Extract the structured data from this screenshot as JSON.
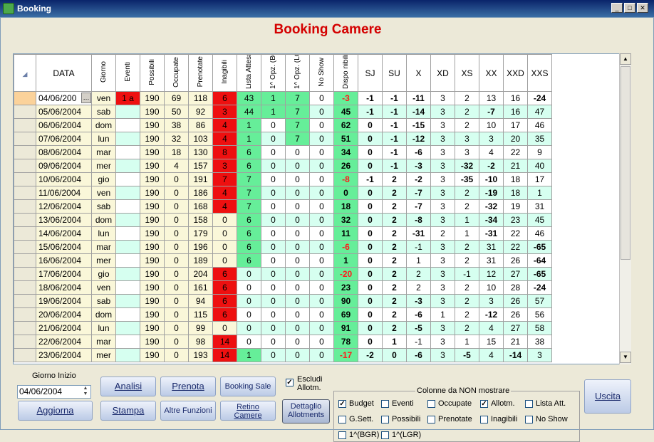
{
  "window": {
    "title": "Booking"
  },
  "heading": "Booking Camere",
  "columns": [
    "Giorno",
    "Eventi",
    "Possibili",
    "Occupate",
    "Prenotate",
    "Inagibili",
    "Lista Attesa",
    "1^ Opz. (BGR)",
    "1^ Opz. (LGR)",
    "No Show",
    "Dispo nibili",
    "SJ",
    "SU",
    "X",
    "XD",
    "XS",
    "XX",
    "XXD",
    "XXS"
  ],
  "data_header": "DATA",
  "colors": {
    "red": "#ee1010",
    "green_light": "#66ee99",
    "cyan_light": "#d6fff0",
    "yellow_light": "#faf7d9",
    "orange": "#fbd29a",
    "dispo_neg": "#ff1a1a",
    "title_red": "#d40000"
  },
  "rows": [
    {
      "date": "04/06/200",
      "day": "ven",
      "eventi": "1 a",
      "poss": "190",
      "occ": "69",
      "pren": "118",
      "inag": "6",
      "lista": "43",
      "bgr": "1",
      "lgr": "7",
      "noshow": "0",
      "dispo": "-3",
      "sj": "-1",
      "su": "-1",
      "x": "-11",
      "xd": "3",
      "xs": "2",
      "xx": "13",
      "xxd": "16",
      "xxs": "-24"
    },
    {
      "date": "05/06/2004",
      "day": "sab",
      "eventi": "",
      "poss": "190",
      "occ": "50",
      "pren": "92",
      "inag": "3",
      "lista": "44",
      "bgr": "1",
      "lgr": "7",
      "noshow": "0",
      "dispo": "45",
      "sj": "-1",
      "su": "-1",
      "x": "-14",
      "xd": "3",
      "xs": "2",
      "xx": "-7",
      "xxd": "16",
      "xxs": "47"
    },
    {
      "date": "06/06/2004",
      "day": "dom",
      "eventi": "",
      "poss": "190",
      "occ": "38",
      "pren": "86",
      "inag": "4",
      "lista": "1",
      "bgr": "0",
      "lgr": "7",
      "noshow": "0",
      "dispo": "62",
      "sj": "0",
      "su": "-1",
      "x": "-15",
      "xd": "3",
      "xs": "2",
      "xx": "10",
      "xxd": "17",
      "xxs": "46"
    },
    {
      "date": "07/06/2004",
      "day": "lun",
      "eventi": "",
      "poss": "190",
      "occ": "32",
      "pren": "103",
      "inag": "4",
      "lista": "1",
      "bgr": "0",
      "lgr": "7",
      "noshow": "0",
      "dispo": "51",
      "sj": "0",
      "su": "-1",
      "x": "-12",
      "xd": "3",
      "xs": "3",
      "xx": "3",
      "xxd": "20",
      "xxs": "35"
    },
    {
      "date": "08/06/2004",
      "day": "mar",
      "eventi": "",
      "poss": "190",
      "occ": "18",
      "pren": "130",
      "inag": "8",
      "lista": "6",
      "bgr": "0",
      "lgr": "0",
      "noshow": "0",
      "dispo": "34",
      "sj": "0",
      "su": "-1",
      "x": "-6",
      "xd": "3",
      "xs": "3",
      "xx": "4",
      "xxd": "22",
      "xxs": "9"
    },
    {
      "date": "09/06/2004",
      "day": "mer",
      "eventi": "",
      "poss": "190",
      "occ": "4",
      "pren": "157",
      "inag": "3",
      "lista": "6",
      "bgr": "0",
      "lgr": "0",
      "noshow": "0",
      "dispo": "26",
      "sj": "0",
      "su": "-1",
      "x": "-3",
      "xd": "3",
      "xs": "-32",
      "xx": "-2",
      "xxd": "21",
      "xxs": "40"
    },
    {
      "date": "10/06/2004",
      "day": "gio",
      "eventi": "",
      "poss": "190",
      "occ": "0",
      "pren": "191",
      "inag": "7",
      "lista": "7",
      "bgr": "0",
      "lgr": "0",
      "noshow": "0",
      "dispo": "-8",
      "sj": "-1",
      "su": "2",
      "x": "-2",
      "xd": "3",
      "xs": "-35",
      "xx": "-10",
      "xxd": "18",
      "xxs": "17"
    },
    {
      "date": "11/06/2004",
      "day": "ven",
      "eventi": "",
      "poss": "190",
      "occ": "0",
      "pren": "186",
      "inag": "4",
      "lista": "7",
      "bgr": "0",
      "lgr": "0",
      "noshow": "0",
      "dispo": "0",
      "sj": "0",
      "su": "2",
      "x": "-7",
      "xd": "3",
      "xs": "2",
      "xx": "-19",
      "xxd": "18",
      "xxs": "1"
    },
    {
      "date": "12/06/2004",
      "day": "sab",
      "eventi": "",
      "poss": "190",
      "occ": "0",
      "pren": "168",
      "inag": "4",
      "lista": "7",
      "bgr": "0",
      "lgr": "0",
      "noshow": "0",
      "dispo": "18",
      "sj": "0",
      "su": "2",
      "x": "-7",
      "xd": "3",
      "xs": "2",
      "xx": "-32",
      "xxd": "19",
      "xxs": "31"
    },
    {
      "date": "13/06/2004",
      "day": "dom",
      "eventi": "",
      "poss": "190",
      "occ": "0",
      "pren": "158",
      "inag": "0",
      "lista": "6",
      "bgr": "0",
      "lgr": "0",
      "noshow": "0",
      "dispo": "32",
      "sj": "0",
      "su": "2",
      "x": "-8",
      "xd": "3",
      "xs": "1",
      "xx": "-34",
      "xxd": "23",
      "xxs": "45"
    },
    {
      "date": "14/06/2004",
      "day": "lun",
      "eventi": "",
      "poss": "190",
      "occ": "0",
      "pren": "179",
      "inag": "0",
      "lista": "6",
      "bgr": "0",
      "lgr": "0",
      "noshow": "0",
      "dispo": "11",
      "sj": "0",
      "su": "2",
      "x": "-31",
      "xd": "2",
      "xs": "1",
      "xx": "-31",
      "xxd": "22",
      "xxs": "46"
    },
    {
      "date": "15/06/2004",
      "day": "mar",
      "eventi": "",
      "poss": "190",
      "occ": "0",
      "pren": "196",
      "inag": "0",
      "lista": "6",
      "bgr": "0",
      "lgr": "0",
      "noshow": "0",
      "dispo": "-6",
      "sj": "0",
      "su": "2",
      "x": "-1",
      "xd": "3",
      "xs": "2",
      "xx": "31",
      "xxd": "22",
      "xxs": "-65"
    },
    {
      "date": "16/06/2004",
      "day": "mer",
      "eventi": "",
      "poss": "190",
      "occ": "0",
      "pren": "189",
      "inag": "0",
      "lista": "6",
      "bgr": "0",
      "lgr": "0",
      "noshow": "0",
      "dispo": "1",
      "sj": "0",
      "su": "2",
      "x": "1",
      "xd": "3",
      "xs": "2",
      "xx": "31",
      "xxd": "26",
      "xxs": "-64"
    },
    {
      "date": "17/06/2004",
      "day": "gio",
      "eventi": "",
      "poss": "190",
      "occ": "0",
      "pren": "204",
      "inag": "6",
      "lista": "0",
      "bgr": "0",
      "lgr": "0",
      "noshow": "0",
      "dispo": "-20",
      "sj": "0",
      "su": "2",
      "x": "2",
      "xd": "3",
      "xs": "-1",
      "xx": "12",
      "xxd": "27",
      "xxs": "-65"
    },
    {
      "date": "18/06/2004",
      "day": "ven",
      "eventi": "",
      "poss": "190",
      "occ": "0",
      "pren": "161",
      "inag": "6",
      "lista": "0",
      "bgr": "0",
      "lgr": "0",
      "noshow": "0",
      "dispo": "23",
      "sj": "0",
      "su": "2",
      "x": "2",
      "xd": "3",
      "xs": "2",
      "xx": "10",
      "xxd": "28",
      "xxs": "-24"
    },
    {
      "date": "19/06/2004",
      "day": "sab",
      "eventi": "",
      "poss": "190",
      "occ": "0",
      "pren": "94",
      "inag": "6",
      "lista": "0",
      "bgr": "0",
      "lgr": "0",
      "noshow": "0",
      "dispo": "90",
      "sj": "0",
      "su": "2",
      "x": "-3",
      "xd": "3",
      "xs": "2",
      "xx": "3",
      "xxd": "26",
      "xxs": "57"
    },
    {
      "date": "20/06/2004",
      "day": "dom",
      "eventi": "",
      "poss": "190",
      "occ": "0",
      "pren": "115",
      "inag": "6",
      "lista": "0",
      "bgr": "0",
      "lgr": "0",
      "noshow": "0",
      "dispo": "69",
      "sj": "0",
      "su": "2",
      "x": "-6",
      "xd": "1",
      "xs": "2",
      "xx": "-12",
      "xxd": "26",
      "xxs": "56"
    },
    {
      "date": "21/06/2004",
      "day": "lun",
      "eventi": "",
      "poss": "190",
      "occ": "0",
      "pren": "99",
      "inag": "0",
      "lista": "0",
      "bgr": "0",
      "lgr": "0",
      "noshow": "0",
      "dispo": "91",
      "sj": "0",
      "su": "2",
      "x": "-5",
      "xd": "3",
      "xs": "2",
      "xx": "4",
      "xxd": "27",
      "xxs": "58"
    },
    {
      "date": "22/06/2004",
      "day": "mar",
      "eventi": "",
      "poss": "190",
      "occ": "0",
      "pren": "98",
      "inag": "14",
      "lista": "0",
      "bgr": "0",
      "lgr": "0",
      "noshow": "0",
      "dispo": "78",
      "sj": "0",
      "su": "1",
      "x": "-1",
      "xd": "3",
      "xs": "1",
      "xx": "15",
      "xxd": "21",
      "xxs": "38"
    },
    {
      "date": "23/06/2004",
      "day": "mer",
      "eventi": "",
      "poss": "190",
      "occ": "0",
      "pren": "193",
      "inag": "14",
      "lista": "1",
      "bgr": "0",
      "lgr": "0",
      "noshow": "0",
      "dispo": "-17",
      "sj": "-2",
      "su": "0",
      "x": "-6",
      "xd": "3",
      "xs": "-5",
      "xx": "4",
      "xxd": "-14",
      "xxs": "3"
    }
  ],
  "controls": {
    "giorno_inizio_label": "Giorno Inizio",
    "giorno_inizio_value": "04/06/2004",
    "analisi": "Analisi",
    "prenota": "Prenota",
    "booking_sale": "Booking Sale",
    "aggiorna": "Aggiorna",
    "stampa": "Stampa",
    "altre_funzioni": "Altre Funzioni",
    "retino_camere": "Retino Camere",
    "escludi_allotm": "Escludi Allotm.",
    "dettaglio_allotments": "Dettaglio Allotments",
    "uscita": "Uscita"
  },
  "hide_columns": {
    "legend": "Colonne da NON mostrare",
    "items": [
      {
        "label": "Budget",
        "checked": true
      },
      {
        "label": "Eventi",
        "checked": false
      },
      {
        "label": "Occupate",
        "checked": false
      },
      {
        "label": "Allotm.",
        "checked": true
      },
      {
        "label": "Lista Att.",
        "checked": false
      },
      {
        "label": "G.Sett.",
        "checked": false
      },
      {
        "label": "Possibili",
        "checked": false
      },
      {
        "label": "Prenotate",
        "checked": false
      },
      {
        "label": "Inagibili",
        "checked": false
      },
      {
        "label": "No Show",
        "checked": false
      },
      {
        "label": "1^(BGR)",
        "checked": false
      },
      {
        "label": "1^(LGR)",
        "checked": false
      }
    ]
  }
}
